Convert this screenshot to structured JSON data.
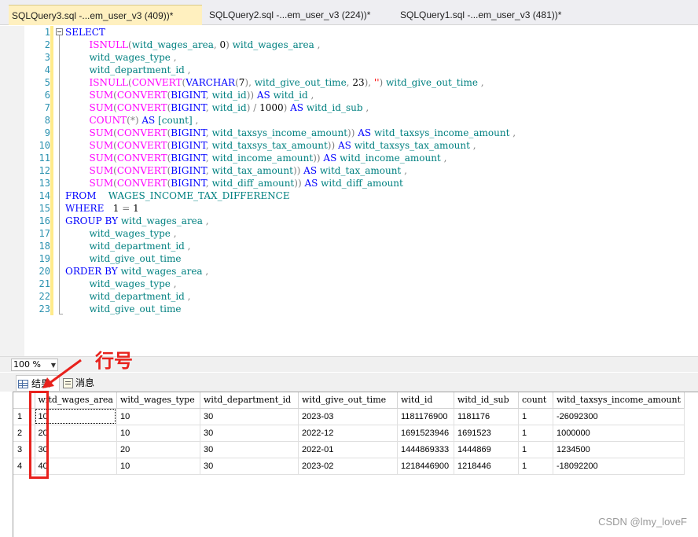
{
  "tabs": [
    {
      "label": "SQLQuery3.sql -...em_user_v3 (409))*",
      "active": true
    },
    {
      "label": "SQLQuery2.sql -...em_user_v3 (224))*",
      "active": false
    },
    {
      "label": "SQLQuery1.sql -...em_user_v3 (481))*",
      "active": false
    }
  ],
  "editor": {
    "line_numbers": [
      "1",
      "2",
      "3",
      "4",
      "5",
      "6",
      "7",
      "8",
      "9",
      "10",
      "11",
      "12",
      "13",
      "14",
      "15",
      "16",
      "17",
      "18",
      "19",
      "20",
      "21",
      "22",
      "23"
    ]
  },
  "zoom": {
    "value": "100 %"
  },
  "result_tabs": {
    "results": "结果",
    "messages": "消息"
  },
  "annotation": {
    "label": "行号",
    "color": "#e8211c"
  },
  "grid": {
    "columns": [
      "witd_wages_area",
      "witd_wages_type",
      "witd_department_id",
      "witd_give_out_time",
      "witd_id",
      "witd_id_sub",
      "count",
      "witd_taxsys_income_amount"
    ],
    "rows": [
      {
        "num": "1",
        "cells": [
          "10",
          "10",
          "30",
          "2023-03",
          "1181176900",
          "1181176",
          "1",
          "-26092300"
        ]
      },
      {
        "num": "2",
        "cells": [
          "20",
          "10",
          "30",
          "2022-12",
          "1691523946",
          "1691523",
          "1",
          "1000000"
        ]
      },
      {
        "num": "3",
        "cells": [
          "30",
          "20",
          "30",
          "2022-01",
          "1444869333",
          "1444869",
          "1",
          "1234500"
        ]
      },
      {
        "num": "4",
        "cells": [
          "40",
          "10",
          "30",
          "2023-02",
          "1218446900",
          "1218446",
          "1",
          "-18092200"
        ]
      }
    ]
  },
  "watermark": "CSDN @lmy_loveF",
  "colors": {
    "keyword": "#0000ff",
    "function": "#ff00ff",
    "identifier": "#008080",
    "operator": "#808080",
    "string": "#ff0000"
  }
}
